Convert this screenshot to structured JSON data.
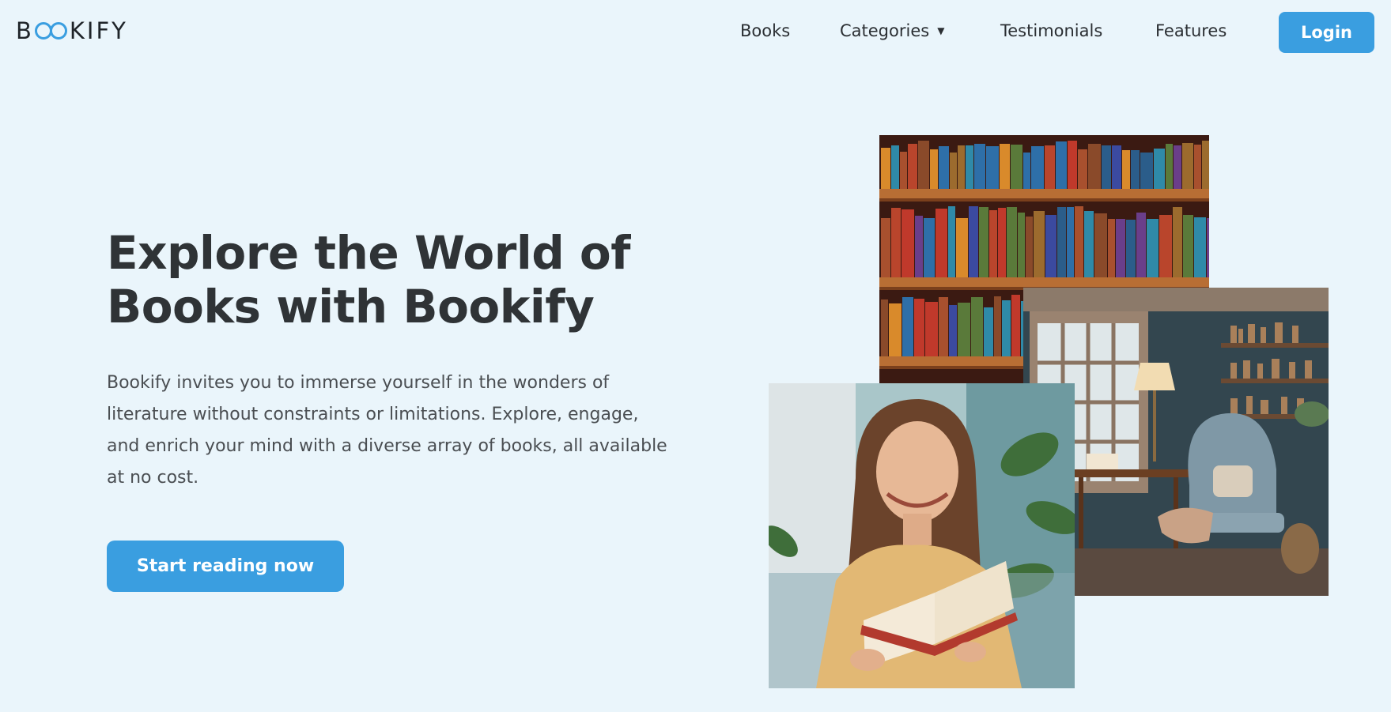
{
  "header": {
    "logo": {
      "before": "B",
      "after": "KIFY",
      "accent_color": "#3a9ee0"
    },
    "nav": {
      "books": "Books",
      "categories": "Categories",
      "testimonials": "Testimonials",
      "features": "Features"
    },
    "login_label": "Login"
  },
  "hero": {
    "title_line1": "Explore the World of",
    "title_line2": "Books with Bookify",
    "description": "Bookify invites you to immerse yourself in the wonders of literature without constraints or limitations. Explore, engage, and enrich your mind with a diverse array of books, all available at no cost.",
    "cta_label": "Start reading now"
  },
  "images": {
    "shelves": "bookshelf-photo",
    "room": "reading-room-photo",
    "reader": "woman-reading-photo"
  },
  "colors": {
    "background": "#eaf5fb",
    "accent": "#3a9ee0",
    "heading": "#2f3336"
  }
}
